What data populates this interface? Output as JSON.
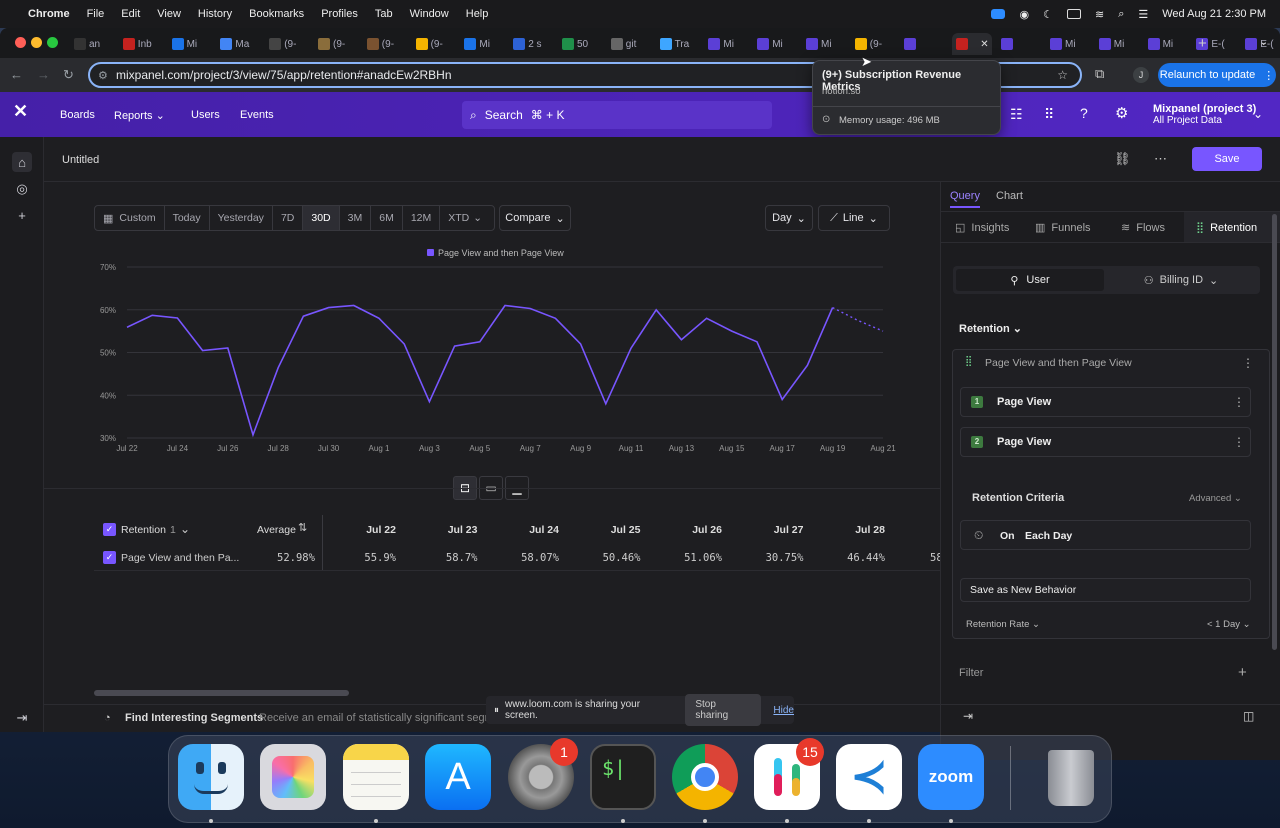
{
  "menubar": {
    "app_name": "Chrome",
    "items": [
      "File",
      "Edit",
      "View",
      "History",
      "Bookmarks",
      "Profiles",
      "Tab",
      "Window",
      "Help"
    ],
    "datetime": "Wed Aug 21  2:30 PM"
  },
  "browser": {
    "tabs": [
      "an",
      "Inb",
      "Mi",
      "Ma",
      "(9-",
      "(9-",
      "(9-",
      "(9-",
      "Mi",
      "2 s",
      "50",
      "git",
      "Tra",
      "Mi",
      "Mi",
      "Mi",
      "(9-",
      "",
      "",
      "",
      "Mi",
      "Mi",
      "Mi",
      "E-(",
      "E-("
    ],
    "url": "mixpanel.com/project/3/view/75/app/retention#anadcEw2RBHn",
    "relaunch_label": "Relaunch to update",
    "profile_initial": "J",
    "tab_tooltip": {
      "title": "(9+) Subscription Revenue Metrics",
      "domain": "notion.so",
      "memory": "Memory usage: 496 MB"
    }
  },
  "header": {
    "nav": [
      "Boards",
      "Reports",
      "Users",
      "Events"
    ],
    "search_label": "Search",
    "search_shortcut": "⌘ + K",
    "project_name": "Mixpanel (project 3)",
    "project_sub": "All Project Data"
  },
  "report": {
    "title": "Untitled",
    "save_label": "Save"
  },
  "controls": {
    "date_ranges": [
      "Custom",
      "Today",
      "Yesterday",
      "7D",
      "30D",
      "3M",
      "6M",
      "12M",
      "XTD"
    ],
    "selected_range": "30D",
    "compare_label": "Compare",
    "granularity": "Day",
    "chart_type_label": "Line"
  },
  "chart_data": {
    "type": "line",
    "legend": [
      "Page View and then Page View"
    ],
    "yticks": [
      "70%",
      "60%",
      "50%",
      "40%",
      "30%"
    ],
    "ylim": [
      30,
      70
    ],
    "xticks": [
      "Jul 22",
      "Jul 24",
      "Jul 26",
      "Jul 28",
      "Jul 30",
      "Aug 1",
      "Aug 3",
      "Aug 5",
      "Aug 7",
      "Aug 9",
      "Aug 11",
      "Aug 13",
      "Aug 15",
      "Aug 17",
      "Aug 19",
      "Aug 21"
    ],
    "series": [
      {
        "name": "Page View and then Page View",
        "color": "#7856ff",
        "x": [
          "Jul 22",
          "Jul 23",
          "Jul 24",
          "Jul 25",
          "Jul 26",
          "Jul 27",
          "Jul 28",
          "Jul 29",
          "Jul 30",
          "Jul 31",
          "Aug 1",
          "Aug 2",
          "Aug 3",
          "Aug 4",
          "Aug 5",
          "Aug 6",
          "Aug 7",
          "Aug 8",
          "Aug 9",
          "Aug 10",
          "Aug 11",
          "Aug 12",
          "Aug 13",
          "Aug 14",
          "Aug 15",
          "Aug 16",
          "Aug 17",
          "Aug 18",
          "Aug 19",
          "Aug 20",
          "Aug 21"
        ],
        "values": [
          55.9,
          58.7,
          58.07,
          50.46,
          51.06,
          30.75,
          46.44,
          58.5,
          60.5,
          61.0,
          58.0,
          52.0,
          38.5,
          51.5,
          52.5,
          61.0,
          60.3,
          58.0,
          52.0,
          38.0,
          51.0,
          60.0,
          53.0,
          58.0,
          55.0,
          52.5,
          39.0,
          47.0,
          60.5,
          57.5,
          55.0
        ],
        "incomplete_from": "Aug 19"
      }
    ]
  },
  "table": {
    "header_label": "Retention",
    "header_count": "1",
    "average_label": "Average",
    "columns": [
      "Jul 22",
      "Jul 23",
      "Jul 24",
      "Jul 25",
      "Jul 26",
      "Jul 27",
      "Jul 28"
    ],
    "row": {
      "label": "Page View and then Pa...",
      "average": "52.98%",
      "values": [
        "55.9%",
        "58.7%",
        "58.07%",
        "50.46%",
        "51.06%",
        "30.75%",
        "46.44%"
      ],
      "overflow": "58"
    }
  },
  "bottom": {
    "segments_label": "Find Interesting Segments",
    "segments_desc": "Receive an email of statistically significant segments"
  },
  "loom": {
    "text": "www.loom.com is sharing your screen.",
    "stop_label": "Stop sharing",
    "hide_label": "Hide"
  },
  "panel": {
    "tabs": [
      "Query",
      "Chart"
    ],
    "report_types": [
      "Insights",
      "Funnels",
      "Flows",
      "Retention"
    ],
    "active_report": "Retention",
    "entity_user": "User",
    "entity_billing": "Billing ID",
    "section_label": "Retention",
    "behavior_label": "Page View and then Page View",
    "steps": [
      {
        "num": "1",
        "label": "Page View"
      },
      {
        "num": "2",
        "label": "Page View"
      }
    ],
    "criteria_label": "Retention Criteria",
    "advanced_label": "Advanced",
    "on_label": "On",
    "each_day_label": "Each Day",
    "save_behavior_label": "Save as New Behavior",
    "rate_label": "Retention Rate",
    "rate_value": "< 1 Day",
    "filter_label": "Filter"
  },
  "dock": {
    "apps": [
      "Finder",
      "Launchpad",
      "Notes",
      "App Store",
      "System Settings",
      "Terminal",
      "Chrome",
      "Slack",
      "VS Code",
      "Zoom",
      "Trash"
    ],
    "settings_badge": "1",
    "slack_badge": "15",
    "zoom_label": "zoom",
    "terminal_label": "$|"
  }
}
